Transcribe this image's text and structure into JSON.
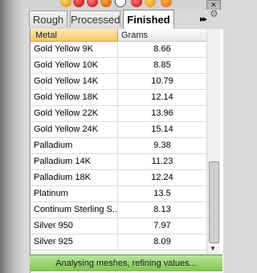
{
  "tabs": [
    {
      "label": "Rough"
    },
    {
      "label": "Processed"
    },
    {
      "label": "Finished"
    }
  ],
  "active_tab": "Finished",
  "more_tabs_glyph": "▸▸",
  "close_glyph": "✕",
  "table": {
    "columns": [
      "Metal",
      "Grams"
    ],
    "rows": [
      {
        "metal": "Gold Yellow 9K",
        "grams": "8.66"
      },
      {
        "metal": "Gold Yellow 10K",
        "grams": "8.85"
      },
      {
        "metal": "Gold Yellow 14K",
        "grams": "10.79"
      },
      {
        "metal": "Gold Yellow 18K",
        "grams": "12.14"
      },
      {
        "metal": "Gold Yellow 22K",
        "grams": "13.96"
      },
      {
        "metal": "Gold Yellow 24K",
        "grams": "15.14"
      },
      {
        "metal": "Palladium",
        "grams": "9.38"
      },
      {
        "metal": "Palladium 14K",
        "grams": "11.23"
      },
      {
        "metal": "Palladium 18K",
        "grams": "12.24"
      },
      {
        "metal": "Platinum",
        "grams": "13.5"
      },
      {
        "metal": "Continum Sterling S...",
        "grams": "8.13"
      },
      {
        "metal": "Silver 950",
        "grams": "7.97"
      },
      {
        "metal": "Silver 925",
        "grams": "8.09"
      }
    ]
  },
  "status": {
    "text": "Analysing meshes, refining values..."
  },
  "colors": {
    "header_accent": "#f8c56a",
    "status_bar": "#7ec34f"
  }
}
